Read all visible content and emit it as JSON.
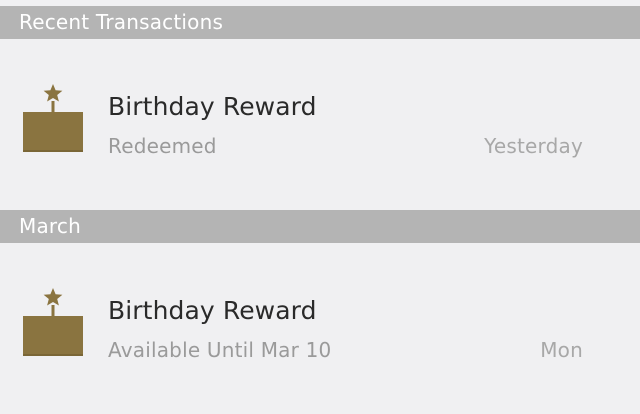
{
  "sections": [
    {
      "header": "Recent Transactions",
      "items": [
        {
          "title": "Birthday Reward",
          "subtitle": "Redeemed",
          "date": "Yesterday",
          "icon": "birthday-cake-icon"
        }
      ]
    },
    {
      "header": "March",
      "items": [
        {
          "title": "Birthday Reward",
          "subtitle": "Available Until Mar 10",
          "date": "Mon",
          "icon": "birthday-cake-icon"
        }
      ]
    }
  ],
  "colors": {
    "header_bg": "#b4b4b4",
    "row_bg": "#f0f0f2",
    "cake_gold": "#8a7440",
    "title_text": "#2a2a2a",
    "secondary_text": "#9a9a9a"
  }
}
